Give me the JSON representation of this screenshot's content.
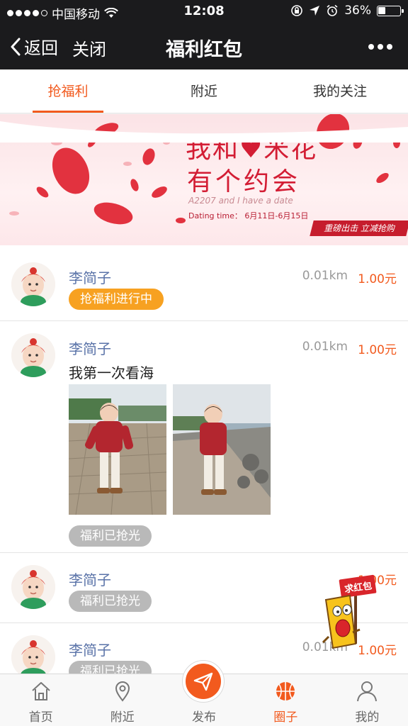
{
  "status_bar": {
    "carrier": "中国移动",
    "time": "12:08",
    "battery": "36%",
    "battery_level": 0.36
  },
  "nav": {
    "back_label": "返回",
    "close_label": "关闭",
    "title": "福利红包"
  },
  "tabs": [
    {
      "label": "抢福利",
      "active": true
    },
    {
      "label": "附近",
      "active": false
    },
    {
      "label": "我的关注",
      "active": false
    }
  ],
  "banner": {
    "headline_1": "我和♥米花",
    "headline_2": "有个约会",
    "subtitle_en": "A2207 and I have a date",
    "dating_time": "Dating time： 6月11日-6月15日",
    "ribbon": "重磅出击 立减抢购"
  },
  "posts": [
    {
      "name": "李简子",
      "distance": "0.01km",
      "amount": "1.00元",
      "status": "抢福利进行中",
      "status_type": "active"
    },
    {
      "name": "李简子",
      "distance": "0.01km",
      "amount": "1.00元",
      "text": "我第一次看海",
      "status": "福利已抢光",
      "status_type": "gone"
    },
    {
      "name": "李简子",
      "distance": "",
      "amount": "1.00元",
      "status": "福利已抢光",
      "status_type": "gone"
    },
    {
      "name": "李简子",
      "distance": "0.01km",
      "amount": "1.00元",
      "status": "福利已抢光",
      "status_type": "gone"
    }
  ],
  "floating_packet": {
    "label": "求红包"
  },
  "tabbar": [
    {
      "label": "首页",
      "icon": "home-icon",
      "active": false
    },
    {
      "label": "附近",
      "icon": "location-icon",
      "active": false
    },
    {
      "label": "发布",
      "icon": "send-icon",
      "active": false
    },
    {
      "label": "圈子",
      "icon": "basketball-icon",
      "active": true
    },
    {
      "label": "我的",
      "icon": "person-icon",
      "active": false
    }
  ],
  "colors": {
    "accent": "#f25a1e",
    "active_pill": "#f7a121",
    "gone_pill": "#b9b9b9",
    "name_blue": "#5a73a8",
    "top_bar": "#1b1b1d"
  }
}
